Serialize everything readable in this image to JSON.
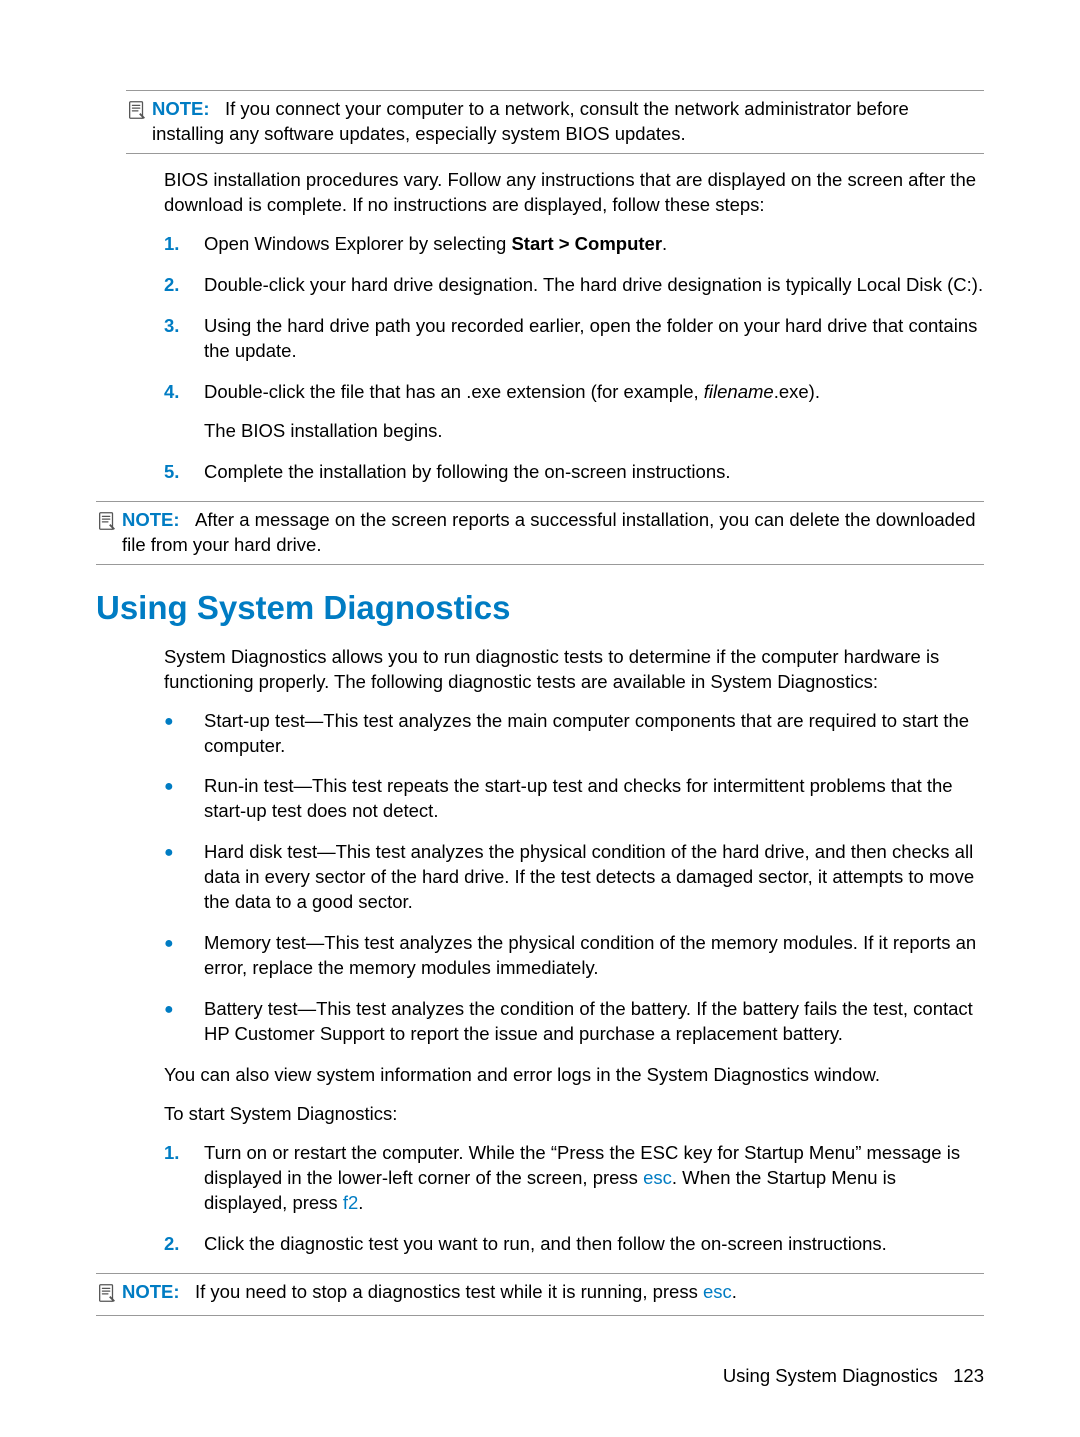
{
  "notes": {
    "note1": {
      "label": "NOTE:",
      "text_a": "If you connect your computer to a network, consult the network administrator before installing any software updates, especially system BIOS updates."
    },
    "note2": {
      "label": "NOTE:",
      "text_a": "After a message on the screen reports a successful installation, you can delete the downloaded file from your hard drive."
    },
    "note3": {
      "label": "NOTE:",
      "text_a": "If you need to stop a diagnostics test while it is running, press ",
      "key": "esc",
      "text_b": "."
    }
  },
  "paras": {
    "p1": "BIOS installation procedures vary. Follow any instructions that are displayed on the screen after the download is complete. If no instructions are displayed, follow these steps:",
    "p2": "System Diagnostics allows you to run diagnostic tests to determine if the computer hardware is functioning properly. The following diagnostic tests are available in System Diagnostics:",
    "p3": "You can also view system information and error logs in the System Diagnostics window.",
    "p4": "To start System Diagnostics:"
  },
  "list1": {
    "i1": {
      "num": "1.",
      "text_a": "Open Windows Explorer by selecting ",
      "bold": "Start > Computer",
      "text_b": "."
    },
    "i2": {
      "num": "2.",
      "text": "Double-click your hard drive designation. The hard drive designation is typically Local Disk (C:)."
    },
    "i3": {
      "num": "3.",
      "text": "Using the hard drive path you recorded earlier, open the folder on your hard drive that contains the update."
    },
    "i4": {
      "num": "4.",
      "text_a": "Double-click the file that has an .exe extension (for example, ",
      "italic": "filename",
      "text_b": ".exe).",
      "follow": "The BIOS installation begins."
    },
    "i5": {
      "num": "5.",
      "text": "Complete the installation by following the on-screen instructions."
    }
  },
  "bullets": {
    "b1": "Start-up test—This test analyzes the main computer components that are required to start the computer.",
    "b2": "Run-in test—This test repeats the start-up test and checks for intermittent problems that the start-up test does not detect.",
    "b3": "Hard disk test—This test analyzes the physical condition of the hard drive, and then checks all data in every sector of the hard drive. If the test detects a damaged sector, it attempts to move the data to a good sector.",
    "b4": "Memory test—This test analyzes the physical condition of the memory modules. If it reports an error, replace the memory modules immediately.",
    "b5": "Battery test—This test analyzes the condition of the battery. If the battery fails the test, contact HP Customer Support to report the issue and purchase a replacement battery."
  },
  "list2": {
    "i1": {
      "num": "1.",
      "text_a": "Turn on or restart the computer. While the “Press the ESC key for Startup Menu” message is displayed in the lower-left corner of the screen, press ",
      "key1": "esc",
      "text_b": ". When the Startup Menu is displayed, press ",
      "key2": "f2",
      "text_c": "."
    },
    "i2": {
      "num": "2.",
      "text": "Click the diagnostic test you want to run, and then follow the on-screen instructions."
    }
  },
  "heading": "Using System Diagnostics",
  "footer": {
    "text": "Using System Diagnostics",
    "page": "123"
  },
  "bullet_char": "●"
}
